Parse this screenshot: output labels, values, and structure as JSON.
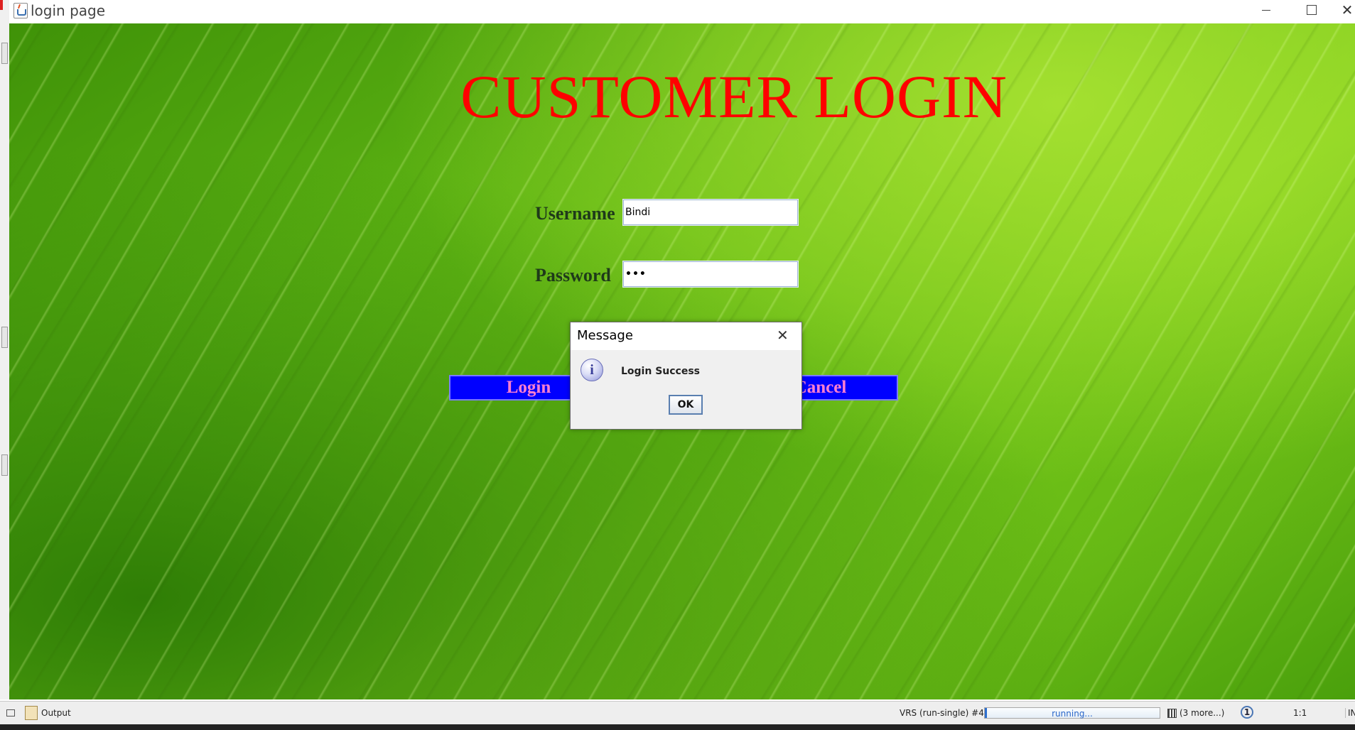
{
  "window": {
    "title": "login page",
    "controls": {
      "minimize": "minimize-icon",
      "maximize": "maximize-icon",
      "close": "✕"
    }
  },
  "form": {
    "heading": "CUSTOMER LOGIN",
    "username_label": "Username",
    "username_value": "Bindi",
    "password_label": "Password",
    "password_value": "•••",
    "login_label": "Login",
    "cancel_label": "Cancel",
    "button_color": "#0000ff",
    "heading_color": "#ff0000"
  },
  "dialog": {
    "title": "Message",
    "close_glyph": "✕",
    "icon_glyph": "i",
    "message": "Login Success",
    "ok_label": "OK"
  },
  "statusbar": {
    "output_label": "Output",
    "task_label": "VRS (run-single) #4",
    "progress_text": "running...",
    "more_tasks": "(3 more...)",
    "notification_count": "1",
    "cursor_position": "1:1",
    "insert_mode": "INS"
  }
}
